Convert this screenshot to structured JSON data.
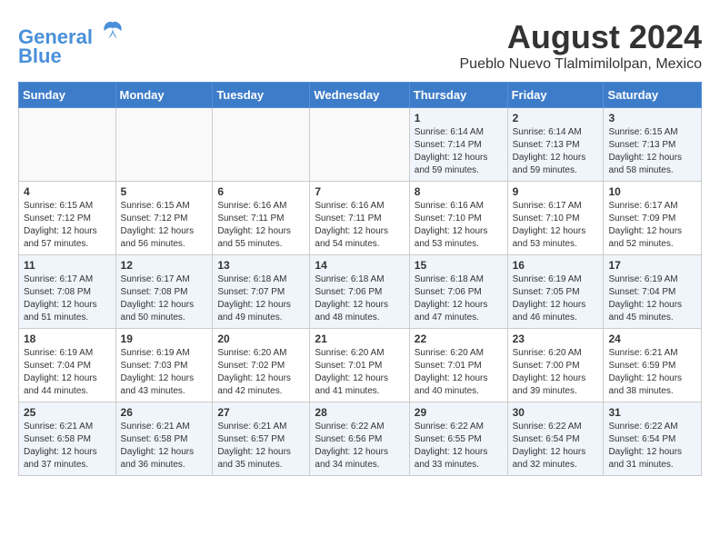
{
  "header": {
    "logo_line1": "General",
    "logo_line2": "Blue",
    "month_year": "August 2024",
    "location": "Pueblo Nuevo Tlalmimilolpan, Mexico"
  },
  "weekdays": [
    "Sunday",
    "Monday",
    "Tuesday",
    "Wednesday",
    "Thursday",
    "Friday",
    "Saturday"
  ],
  "weeks": [
    [
      {
        "day": "",
        "sunrise": "",
        "sunset": "",
        "daylight": ""
      },
      {
        "day": "",
        "sunrise": "",
        "sunset": "",
        "daylight": ""
      },
      {
        "day": "",
        "sunrise": "",
        "sunset": "",
        "daylight": ""
      },
      {
        "day": "",
        "sunrise": "",
        "sunset": "",
        "daylight": ""
      },
      {
        "day": "1",
        "sunrise": "Sunrise: 6:14 AM",
        "sunset": "Sunset: 7:14 PM",
        "daylight": "Daylight: 12 hours and 59 minutes."
      },
      {
        "day": "2",
        "sunrise": "Sunrise: 6:14 AM",
        "sunset": "Sunset: 7:13 PM",
        "daylight": "Daylight: 12 hours and 59 minutes."
      },
      {
        "day": "3",
        "sunrise": "Sunrise: 6:15 AM",
        "sunset": "Sunset: 7:13 PM",
        "daylight": "Daylight: 12 hours and 58 minutes."
      }
    ],
    [
      {
        "day": "4",
        "sunrise": "Sunrise: 6:15 AM",
        "sunset": "Sunset: 7:12 PM",
        "daylight": "Daylight: 12 hours and 57 minutes."
      },
      {
        "day": "5",
        "sunrise": "Sunrise: 6:15 AM",
        "sunset": "Sunset: 7:12 PM",
        "daylight": "Daylight: 12 hours and 56 minutes."
      },
      {
        "day": "6",
        "sunrise": "Sunrise: 6:16 AM",
        "sunset": "Sunset: 7:11 PM",
        "daylight": "Daylight: 12 hours and 55 minutes."
      },
      {
        "day": "7",
        "sunrise": "Sunrise: 6:16 AM",
        "sunset": "Sunset: 7:11 PM",
        "daylight": "Daylight: 12 hours and 54 minutes."
      },
      {
        "day": "8",
        "sunrise": "Sunrise: 6:16 AM",
        "sunset": "Sunset: 7:10 PM",
        "daylight": "Daylight: 12 hours and 53 minutes."
      },
      {
        "day": "9",
        "sunrise": "Sunrise: 6:17 AM",
        "sunset": "Sunset: 7:10 PM",
        "daylight": "Daylight: 12 hours and 53 minutes."
      },
      {
        "day": "10",
        "sunrise": "Sunrise: 6:17 AM",
        "sunset": "Sunset: 7:09 PM",
        "daylight": "Daylight: 12 hours and 52 minutes."
      }
    ],
    [
      {
        "day": "11",
        "sunrise": "Sunrise: 6:17 AM",
        "sunset": "Sunset: 7:08 PM",
        "daylight": "Daylight: 12 hours and 51 minutes."
      },
      {
        "day": "12",
        "sunrise": "Sunrise: 6:17 AM",
        "sunset": "Sunset: 7:08 PM",
        "daylight": "Daylight: 12 hours and 50 minutes."
      },
      {
        "day": "13",
        "sunrise": "Sunrise: 6:18 AM",
        "sunset": "Sunset: 7:07 PM",
        "daylight": "Daylight: 12 hours and 49 minutes."
      },
      {
        "day": "14",
        "sunrise": "Sunrise: 6:18 AM",
        "sunset": "Sunset: 7:06 PM",
        "daylight": "Daylight: 12 hours and 48 minutes."
      },
      {
        "day": "15",
        "sunrise": "Sunrise: 6:18 AM",
        "sunset": "Sunset: 7:06 PM",
        "daylight": "Daylight: 12 hours and 47 minutes."
      },
      {
        "day": "16",
        "sunrise": "Sunrise: 6:19 AM",
        "sunset": "Sunset: 7:05 PM",
        "daylight": "Daylight: 12 hours and 46 minutes."
      },
      {
        "day": "17",
        "sunrise": "Sunrise: 6:19 AM",
        "sunset": "Sunset: 7:04 PM",
        "daylight": "Daylight: 12 hours and 45 minutes."
      }
    ],
    [
      {
        "day": "18",
        "sunrise": "Sunrise: 6:19 AM",
        "sunset": "Sunset: 7:04 PM",
        "daylight": "Daylight: 12 hours and 44 minutes."
      },
      {
        "day": "19",
        "sunrise": "Sunrise: 6:19 AM",
        "sunset": "Sunset: 7:03 PM",
        "daylight": "Daylight: 12 hours and 43 minutes."
      },
      {
        "day": "20",
        "sunrise": "Sunrise: 6:20 AM",
        "sunset": "Sunset: 7:02 PM",
        "daylight": "Daylight: 12 hours and 42 minutes."
      },
      {
        "day": "21",
        "sunrise": "Sunrise: 6:20 AM",
        "sunset": "Sunset: 7:01 PM",
        "daylight": "Daylight: 12 hours and 41 minutes."
      },
      {
        "day": "22",
        "sunrise": "Sunrise: 6:20 AM",
        "sunset": "Sunset: 7:01 PM",
        "daylight": "Daylight: 12 hours and 40 minutes."
      },
      {
        "day": "23",
        "sunrise": "Sunrise: 6:20 AM",
        "sunset": "Sunset: 7:00 PM",
        "daylight": "Daylight: 12 hours and 39 minutes."
      },
      {
        "day": "24",
        "sunrise": "Sunrise: 6:21 AM",
        "sunset": "Sunset: 6:59 PM",
        "daylight": "Daylight: 12 hours and 38 minutes."
      }
    ],
    [
      {
        "day": "25",
        "sunrise": "Sunrise: 6:21 AM",
        "sunset": "Sunset: 6:58 PM",
        "daylight": "Daylight: 12 hours and 37 minutes."
      },
      {
        "day": "26",
        "sunrise": "Sunrise: 6:21 AM",
        "sunset": "Sunset: 6:58 PM",
        "daylight": "Daylight: 12 hours and 36 minutes."
      },
      {
        "day": "27",
        "sunrise": "Sunrise: 6:21 AM",
        "sunset": "Sunset: 6:57 PM",
        "daylight": "Daylight: 12 hours and 35 minutes."
      },
      {
        "day": "28",
        "sunrise": "Sunrise: 6:22 AM",
        "sunset": "Sunset: 6:56 PM",
        "daylight": "Daylight: 12 hours and 34 minutes."
      },
      {
        "day": "29",
        "sunrise": "Sunrise: 6:22 AM",
        "sunset": "Sunset: 6:55 PM",
        "daylight": "Daylight: 12 hours and 33 minutes."
      },
      {
        "day": "30",
        "sunrise": "Sunrise: 6:22 AM",
        "sunset": "Sunset: 6:54 PM",
        "daylight": "Daylight: 12 hours and 32 minutes."
      },
      {
        "day": "31",
        "sunrise": "Sunrise: 6:22 AM",
        "sunset": "Sunset: 6:54 PM",
        "daylight": "Daylight: 12 hours and 31 minutes."
      }
    ]
  ]
}
